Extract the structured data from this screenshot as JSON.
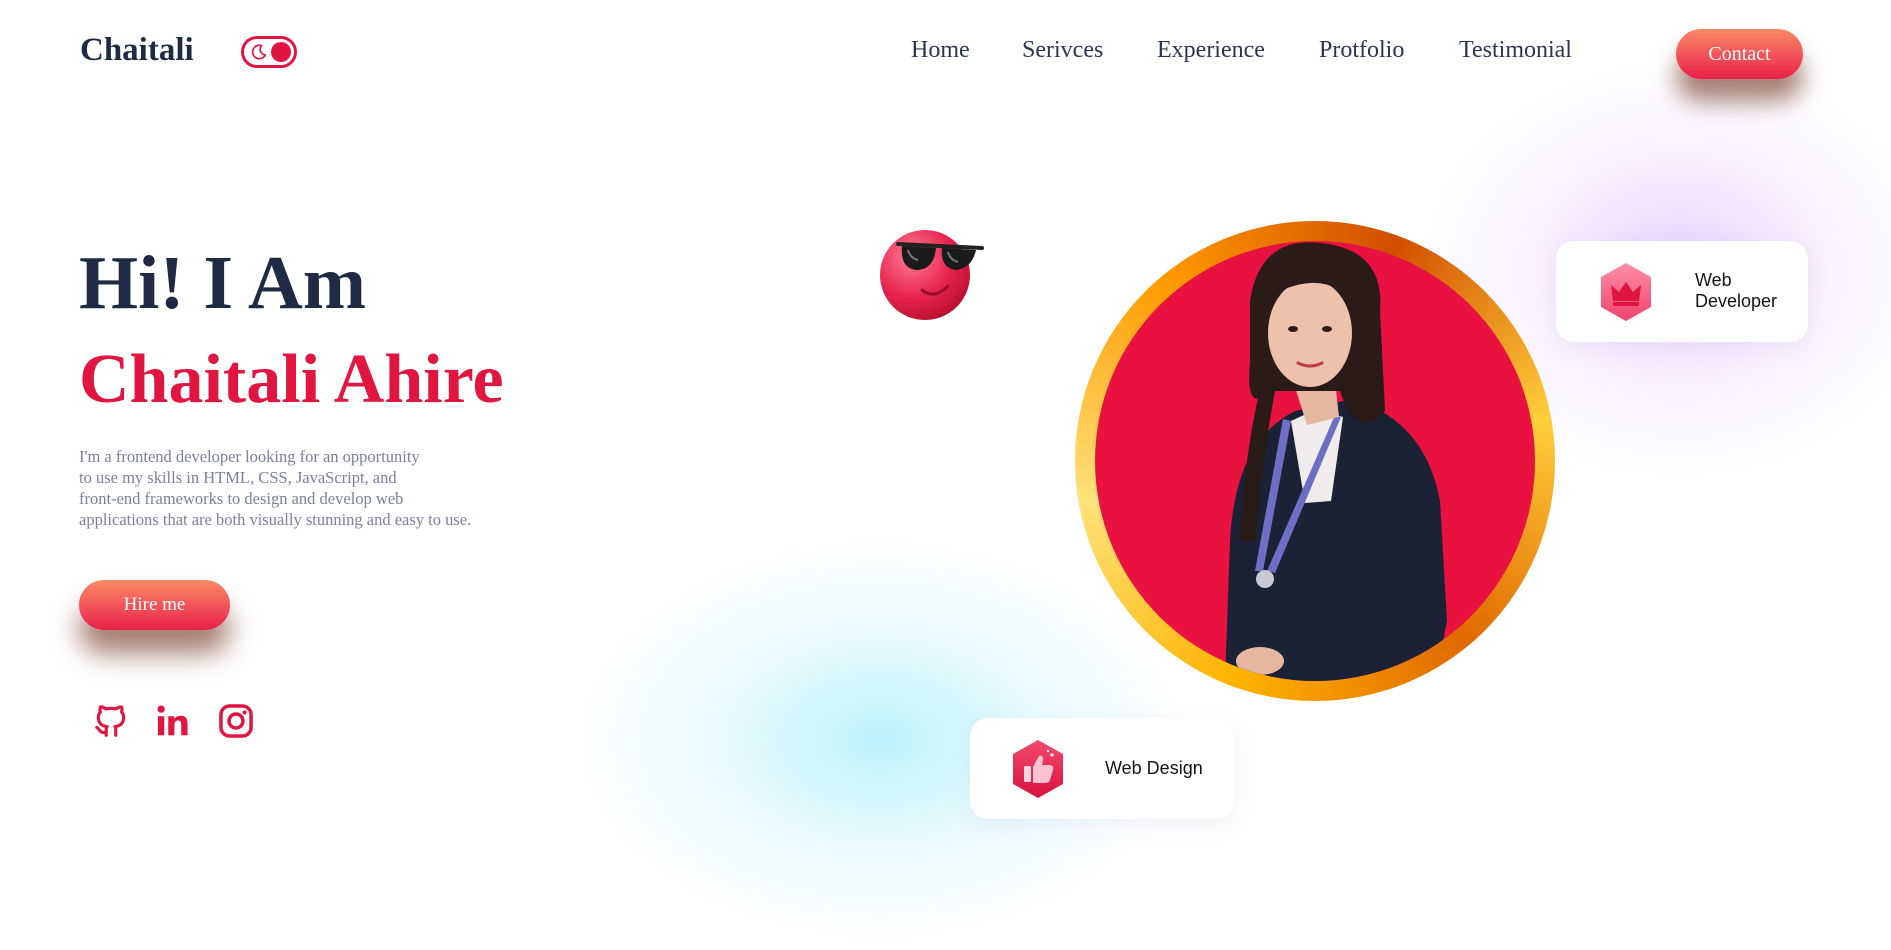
{
  "header": {
    "logo": "Chaitali",
    "nav": [
      "Home",
      "Serivces",
      "Experience",
      "Protfolio",
      "Testimonial"
    ],
    "contact_label": "Contact",
    "toggle_icon": "moon-icon"
  },
  "hero": {
    "greeting": "Hi! I Am",
    "name": "Chaitali Ahire",
    "description": [
      "I'm a frontend developer looking for an opportunity",
      "to use my skills in HTML, CSS, JavaScript, and",
      "front-end frameworks to design and develop web",
      "applications that are both visually stunning and easy to use."
    ],
    "hire_label": "Hire me",
    "social_icons": [
      "github-icon",
      "linkedin-icon",
      "instagram-icon"
    ]
  },
  "cards": {
    "developer": {
      "line1": "Web",
      "line2": "Developer",
      "icon": "crown-icon"
    },
    "design": {
      "label": "Web Design",
      "icon": "thumbs-up-icon"
    }
  },
  "colors": {
    "accent": "#e01540",
    "heading": "#1f2a44",
    "button_gradient_top": "#fb8a67",
    "button_gradient_bottom": "#e8214a",
    "body_text": "#7b8196"
  }
}
